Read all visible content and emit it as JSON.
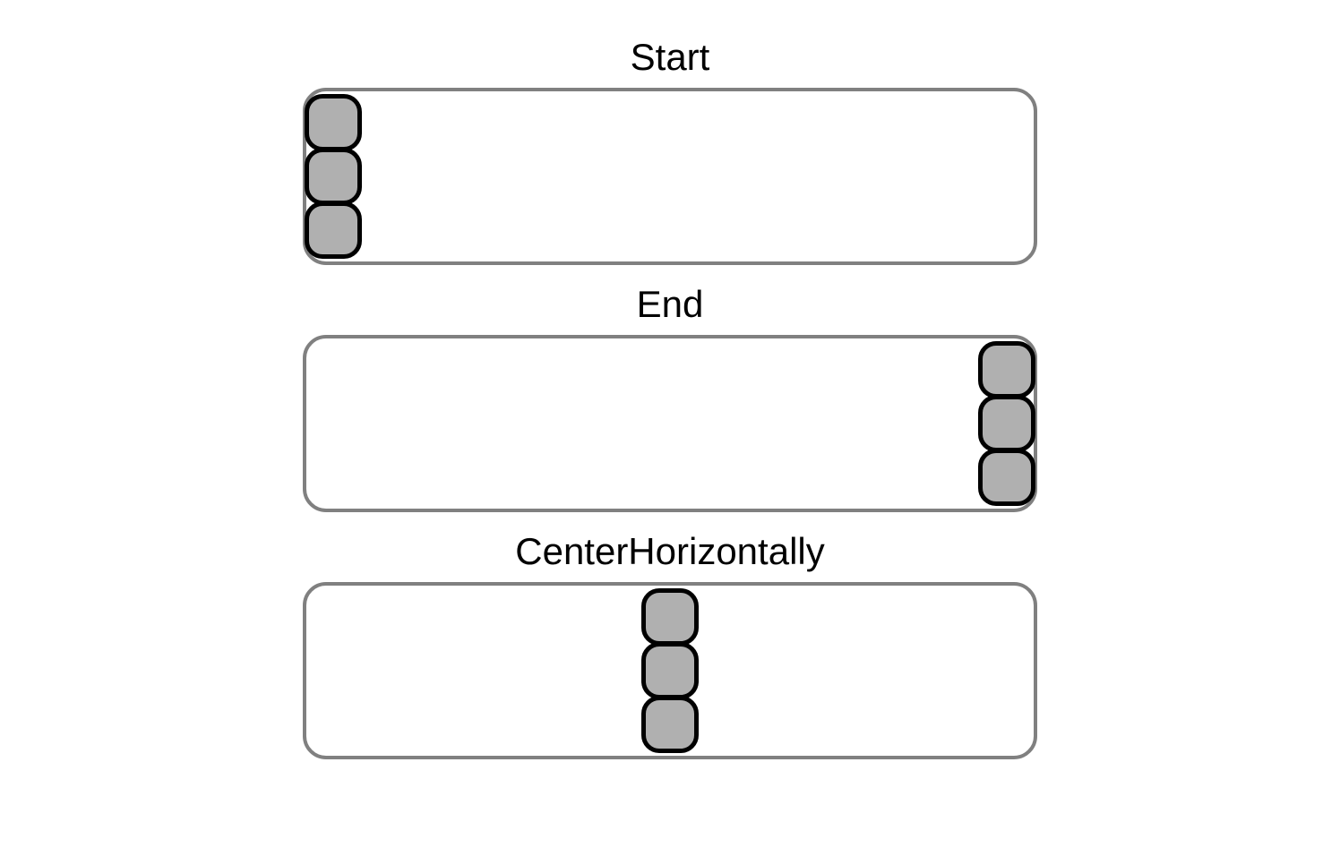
{
  "sections": [
    {
      "label": "Start",
      "alignment": "start"
    },
    {
      "label": "End",
      "alignment": "end"
    },
    {
      "label": "CenterHorizontally",
      "alignment": "center"
    }
  ],
  "items_per_container": 3
}
